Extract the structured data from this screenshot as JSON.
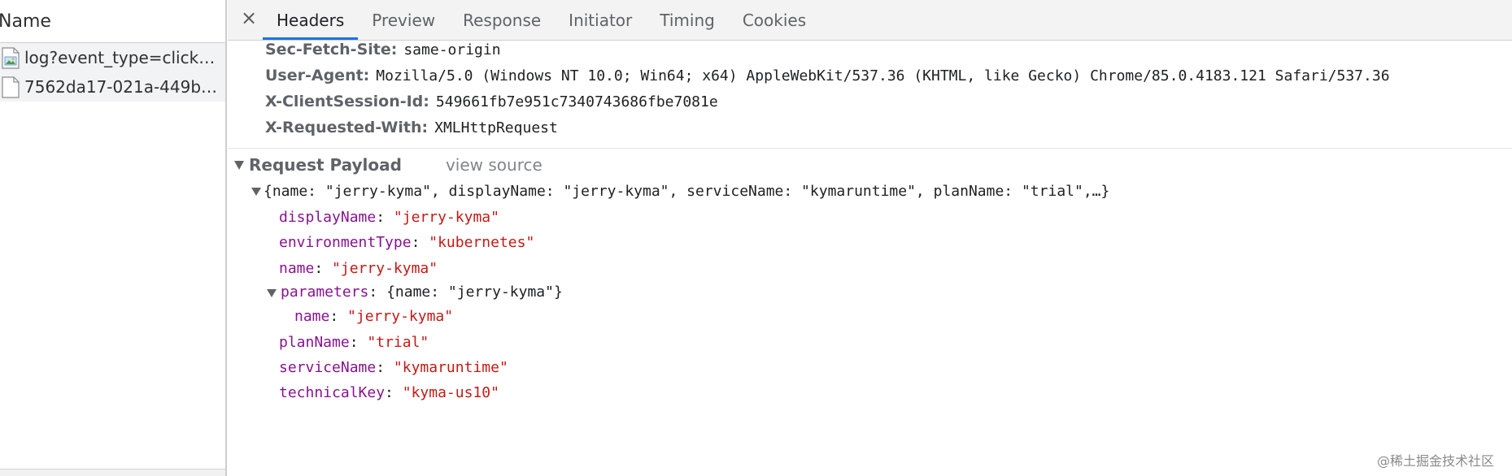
{
  "left_pane": {
    "column_header": "Name",
    "requests": [
      {
        "label": "log?event_type=click&i...",
        "icon": "image-file-icon"
      },
      {
        "label": "7562da17-021a-449b-b...",
        "icon": "document-file-icon"
      }
    ]
  },
  "detail_tabs": {
    "close_symbol": "×",
    "tabs": [
      "Headers",
      "Preview",
      "Response",
      "Initiator",
      "Timing",
      "Cookies"
    ],
    "active": "Headers"
  },
  "request_headers": [
    {
      "key": "Sec-Fetch-Site:",
      "value": "same-origin"
    },
    {
      "key": "User-Agent:",
      "value": "Mozilla/5.0 (Windows NT 10.0; Win64; x64) AppleWebKit/537.36 (KHTML, like Gecko) Chrome/85.0.4183.121 Safari/537.36"
    },
    {
      "key": "X-ClientSession-Id:",
      "value": "549661fb7e951c7340743686fbe7081e"
    },
    {
      "key": "X-Requested-With:",
      "value": "XMLHttpRequest"
    }
  ],
  "payload": {
    "section_title": "Request Payload",
    "view_source_label": "view source",
    "summary": "{name: \"jerry-kyma\", displayName: \"jerry-kyma\", serviceName: \"kymaruntime\", planName: \"trial\",…}",
    "fields": [
      {
        "key": "displayName",
        "value": "\"jerry-kyma\""
      },
      {
        "key": "environmentType",
        "value": "\"kubernetes\""
      },
      {
        "key": "name",
        "value": "\"jerry-kyma\""
      }
    ],
    "parameters": {
      "key": "parameters",
      "summary": "{name: \"jerry-kyma\"}",
      "children": [
        {
          "key": "name",
          "value": "\"jerry-kyma\""
        }
      ]
    },
    "fields_after": [
      {
        "key": "planName",
        "value": "\"trial\""
      },
      {
        "key": "serviceName",
        "value": "\"kymaruntime\""
      },
      {
        "key": "technicalKey",
        "value": "\"kyma-us10\""
      }
    ]
  },
  "watermark": "@稀土掘金技术社区",
  "colors": {
    "json_key": "#881391",
    "json_string": "#c41a16",
    "active_tab_underline": "#1a73e8",
    "header_key": "#5f6368"
  }
}
